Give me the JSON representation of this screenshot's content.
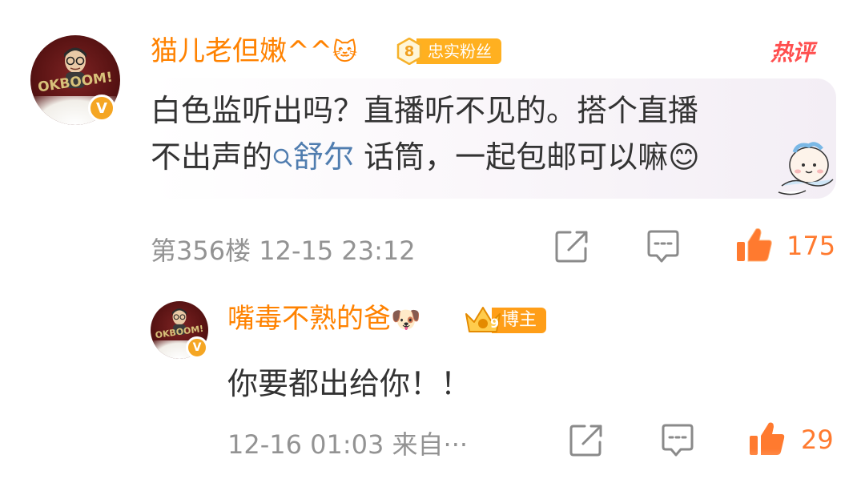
{
  "comment": {
    "username": "猫儿老但嫩^^",
    "username_emoji": "🐱",
    "fan_badge": {
      "level": "8",
      "label": "忠实粉丝"
    },
    "hot_label": "热评",
    "avatar_text": "OKBOOM!",
    "verified_badge": "V",
    "text_line1": "白色监听出吗？直播听不见的。搭个直播",
    "text_line2_prefix": "不出声的",
    "link_text": "舒尔",
    "text_line2_suffix": " 话筒，一起包邮可以嘛",
    "emoji": "😊",
    "meta": "第356楼 12-15 23:12",
    "like_count": "175"
  },
  "reply": {
    "username": "嘴毒不熟的爸",
    "username_emoji": "🐶",
    "blogger_badge": {
      "level": "9",
      "label": "博主"
    },
    "avatar_text": "OKBOOM!",
    "verified_badge": "V",
    "text": "你要都出给你！！",
    "meta": "12-16 01:03 来自···",
    "like_count": "29"
  },
  "colors": {
    "username": "#ff8200",
    "text": "#333333",
    "meta": "#939393",
    "link": "#507daf",
    "like": "#ff7a2f",
    "badge": "#ffb020",
    "hot": "#ff4f4f"
  }
}
